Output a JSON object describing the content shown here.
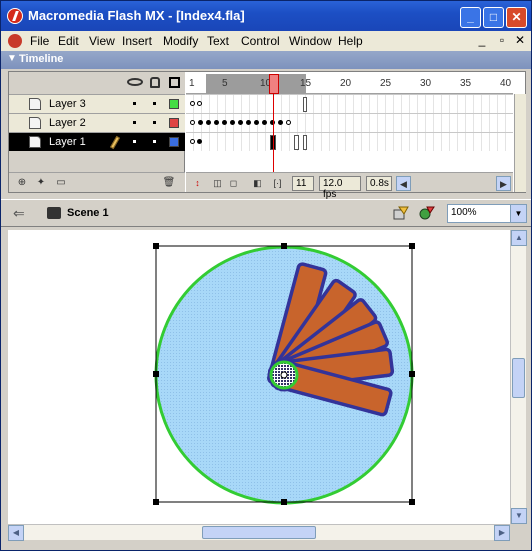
{
  "window": {
    "title": "Macromedia Flash MX - [Index4.fla]"
  },
  "title_buttons": {
    "minimize": "_",
    "maximize": "□",
    "close": "✕"
  },
  "menu": {
    "items": [
      "File",
      "Edit",
      "View",
      "Insert",
      "Modify",
      "Text",
      "Control",
      "Window",
      "Help"
    ],
    "doc_controls": [
      "_",
      "▫",
      "✕"
    ]
  },
  "timeline": {
    "title": "Timeline",
    "ruler_numbers": [
      "1",
      "5",
      "10",
      "15",
      "20",
      "25",
      "30",
      "35",
      "40"
    ],
    "layers": [
      {
        "name": "Layer 3",
        "color": "#44dd44",
        "selected": false
      },
      {
        "name": "Layer 2",
        "color": "#e04444",
        "selected": false
      },
      {
        "name": "Layer 1",
        "color": "#3a6ee0",
        "selected": true
      }
    ],
    "current_frame": "11",
    "frame_rate": "12.0 fps",
    "elapsed_time": "0.8s"
  },
  "editbar": {
    "scene_label": "Scene 1",
    "zoom": "100%"
  },
  "colors": {
    "circle_fill": "#a8d8f8",
    "circle_stroke": "#33cc33",
    "bar_fill": "#c8642c",
    "bar_stroke": "#333399"
  }
}
